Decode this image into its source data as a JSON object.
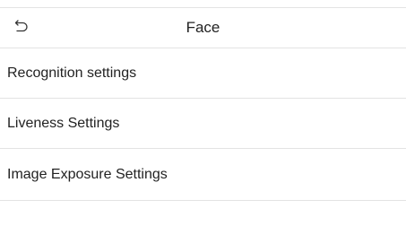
{
  "header": {
    "title": "Face",
    "back_icon": "return-arrow-icon"
  },
  "menu": {
    "items": [
      {
        "label": "Recognition settings"
      },
      {
        "label": "Liveness Settings"
      },
      {
        "label": "Image Exposure Settings"
      }
    ]
  }
}
